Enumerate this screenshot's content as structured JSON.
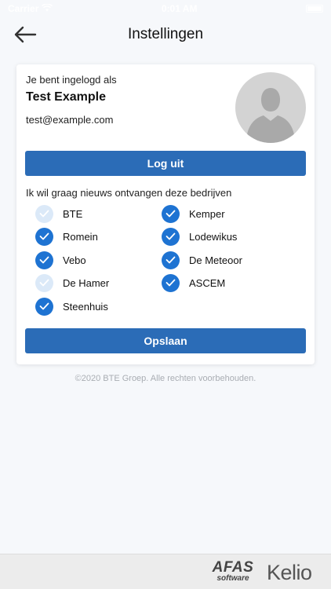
{
  "status_bar": {
    "carrier": "Carrier",
    "time": "0:01 AM"
  },
  "nav": {
    "title": "Instellingen"
  },
  "profile": {
    "logged_in_label": "Je bent ingelogd als",
    "name": "Test Example",
    "email": "test@example.com"
  },
  "logout": {
    "label": "Log uit"
  },
  "news": {
    "label": "Ik wil graag nieuws ontvangen deze bedrijven",
    "companies": [
      {
        "name": "BTE",
        "checked": false
      },
      {
        "name": "Kemper",
        "checked": true
      },
      {
        "name": "Romein",
        "checked": true
      },
      {
        "name": "Lodewikus",
        "checked": true
      },
      {
        "name": "Vebo",
        "checked": true
      },
      {
        "name": "De Meteoor",
        "checked": true
      },
      {
        "name": "De Hamer",
        "checked": false
      },
      {
        "name": "ASCEM",
        "checked": true
      },
      {
        "name": "Steenhuis",
        "checked": true
      }
    ]
  },
  "save": {
    "label": "Opslaan"
  },
  "copyright": "©2020 BTE Groep. Alle rechten voorbehouden.",
  "footer": {
    "afas_main": "AFAS",
    "afas_sub": "software",
    "kelio": "Kelio"
  },
  "colors": {
    "accent": "#2b6cb7",
    "check_on": "#1e73d2",
    "check_off": "#dbe9f8"
  },
  "icons": {
    "back": "arrow-left-icon",
    "check": "checkmark-icon",
    "avatar": "person-silhouette-icon"
  }
}
